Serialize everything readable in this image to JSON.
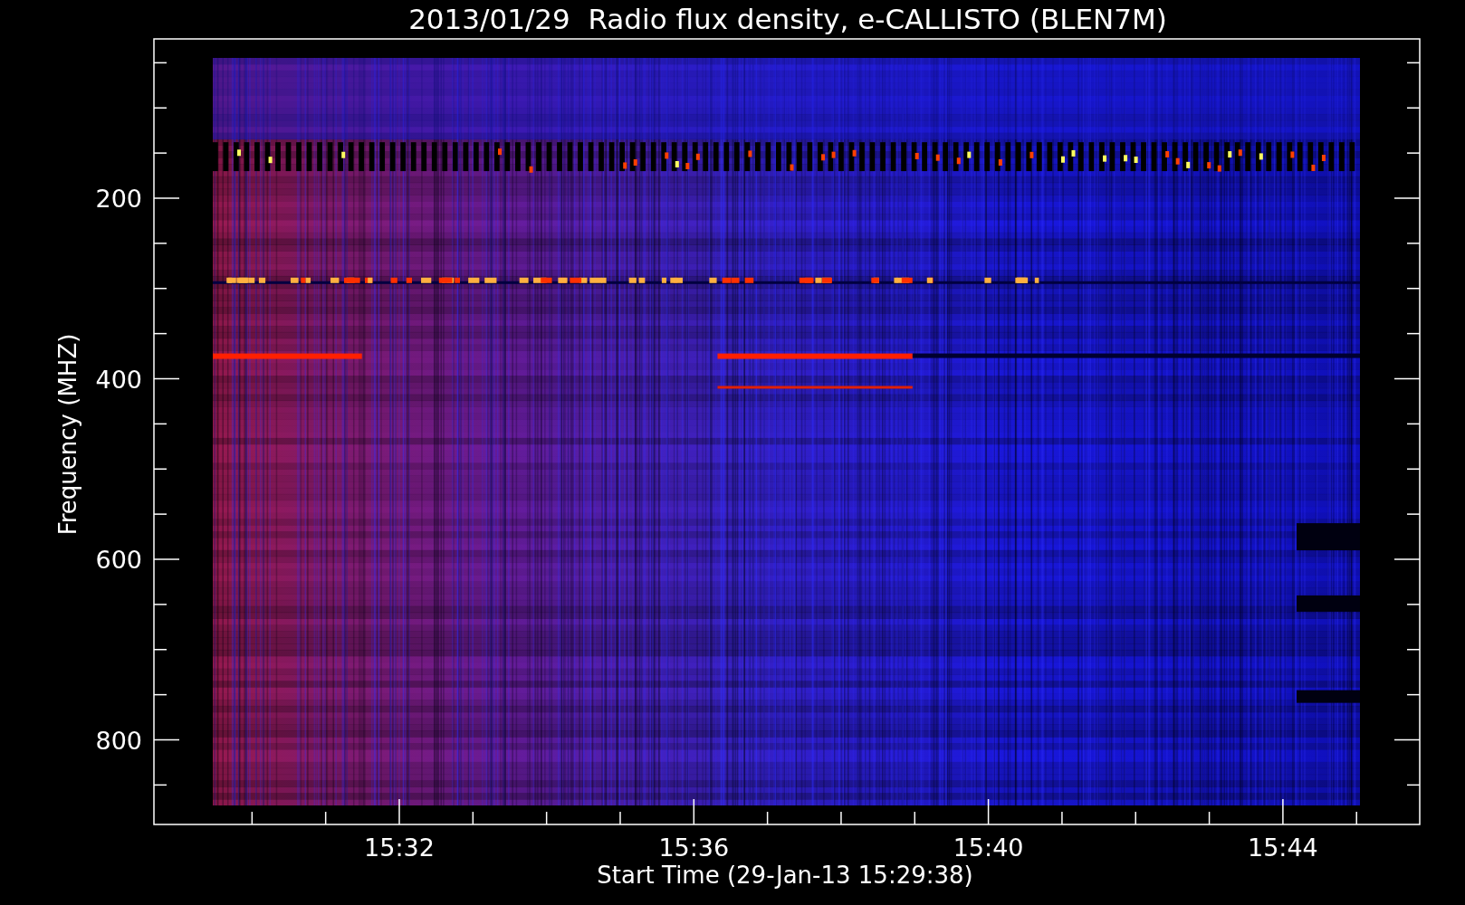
{
  "title": "2013/01/29  Radio flux density, e-CALLISTO (BLEN7M)",
  "y_axis": {
    "label": "Frequency (MHZ)",
    "ticks": [
      "200",
      "400",
      "600",
      "800"
    ]
  },
  "x_axis": {
    "label": "Start Time (29-Jan-13 15:29:38)",
    "ticks": [
      "15:32",
      "15:36",
      "15:40",
      "15:44"
    ]
  }
}
